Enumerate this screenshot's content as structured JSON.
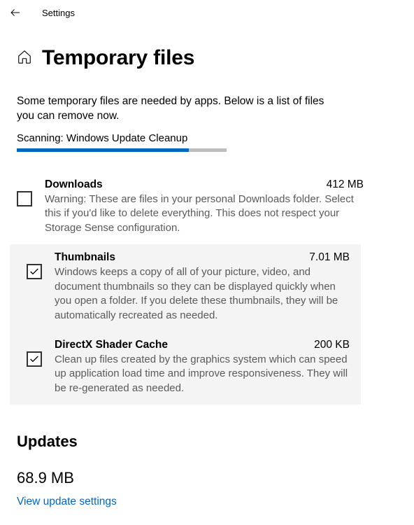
{
  "colors": {
    "accent": "#0067c0",
    "highlight_bg": "#f4f4f4"
  },
  "header": {
    "settings_label": "Settings"
  },
  "page": {
    "title": "Temporary files",
    "intro": "Some temporary files are needed by apps. Below is a list of files you can remove now.",
    "scan_status": "Scanning: Windows Update Cleanup",
    "progress_percent": 82
  },
  "items": [
    {
      "name": "Downloads",
      "size": "412 MB",
      "checked": false,
      "highlighted": false,
      "desc": "Warning: These are files in your personal Downloads folder. Select this if you'd like to delete everything. This does not respect your Storage Sense configuration."
    },
    {
      "name": "Thumbnails",
      "size": "7.01 MB",
      "checked": true,
      "highlighted": true,
      "desc": "Windows keeps a copy of all of your picture, video, and document thumbnails so they can be displayed quickly when you open a folder. If you delete these thumbnails, they will be automatically recreated as needed."
    },
    {
      "name": "DirectX Shader Cache",
      "size": "200 KB",
      "checked": true,
      "highlighted": true,
      "desc": "Clean up files created by the graphics system which can speed up application load time and improve responsiveness. They will be re-generated as needed."
    }
  ],
  "updates": {
    "heading": "Updates",
    "size": "68.9 MB",
    "link_label": "View update settings"
  }
}
